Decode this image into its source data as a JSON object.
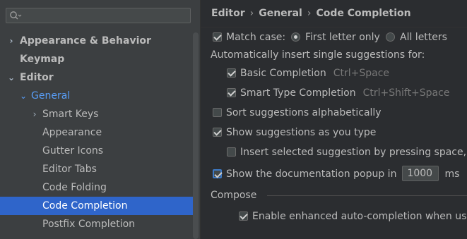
{
  "search": {
    "placeholder": "",
    "value": ""
  },
  "tree": {
    "items": [
      {
        "label": "Appearance & Behavior"
      },
      {
        "label": "Keymap"
      },
      {
        "label": "Editor"
      },
      {
        "label": "General"
      },
      {
        "label": "Smart Keys"
      },
      {
        "label": "Appearance"
      },
      {
        "label": "Gutter Icons"
      },
      {
        "label": "Editor Tabs"
      },
      {
        "label": "Code Folding"
      },
      {
        "label": "Code Completion"
      },
      {
        "label": "Postfix Completion"
      }
    ]
  },
  "breadcrumb": {
    "part1": "Editor",
    "part2": "General",
    "part3": "Code Completion",
    "separator": "›"
  },
  "settings": {
    "match_case": {
      "label": "Match case:",
      "checked": true
    },
    "first_letter_only": {
      "label": "First letter only",
      "selected": true
    },
    "all_letters": {
      "label": "All letters",
      "selected": false
    },
    "auto_insert_header": "Automatically insert single suggestions for:",
    "basic_completion": {
      "label": "Basic Completion",
      "shortcut": "Ctrl+Space",
      "checked": true
    },
    "smart_type_completion": {
      "label": "Smart Type Completion",
      "shortcut": "Ctrl+Shift+Space",
      "checked": true
    },
    "sort_alphabetically": {
      "label": "Sort suggestions alphabetically",
      "checked": false
    },
    "show_as_you_type": {
      "label": "Show suggestions as you type",
      "checked": true
    },
    "insert_by_space": {
      "label": "Insert selected suggestion by pressing space, d",
      "checked": false
    },
    "documentation_popup": {
      "label": "Show the documentation popup in",
      "value": "1000",
      "unit": "ms",
      "checked": true
    },
    "compose_section": "Compose",
    "enhanced_autocompletion": {
      "label": "Enable enhanced auto-completion when usin",
      "checked": true
    }
  },
  "colors": {
    "accent": "#2f65ca",
    "link_blue": "#589df6",
    "sidebar_bg": "#3c3f41",
    "content_bg": "#2b2d30"
  }
}
